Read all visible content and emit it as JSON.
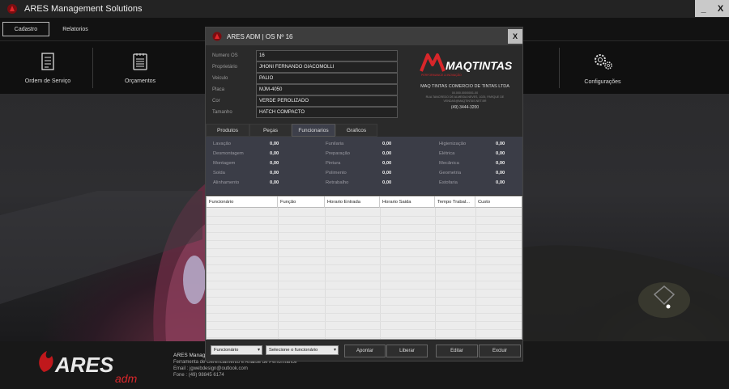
{
  "window": {
    "title": "ARES Management Solutions",
    "minimize_label": "_",
    "close_label": "X"
  },
  "menu": {
    "items": [
      {
        "label": "Cadastro"
      },
      {
        "label": "Relatorios"
      }
    ]
  },
  "ribbon": {
    "items": [
      {
        "label": "Ordem de Serviço",
        "icon": "document-icon"
      },
      {
        "label": "Orçamentos",
        "icon": "list-icon"
      },
      {
        "label": "Configurações",
        "icon": "gears-icon"
      }
    ]
  },
  "footer": {
    "brand_main": "ARES",
    "brand_sub": "adm",
    "app_name": "ARES Manage",
    "app_desc": "Ferramenta de Gerenciamento e Análise de Performance",
    "email_label": "Email",
    "email": "jgwebdesign@outlook.com",
    "phone_label": "Fone",
    "phone": "(49) 98845 6174"
  },
  "modal": {
    "title": "ARES ADM | OS Nº 16",
    "close_label": "X",
    "fields": [
      {
        "label": "Numero OS",
        "value": "16"
      },
      {
        "label": "Proprietário",
        "value": "JHONI FERNANDO GIACOMOLLI"
      },
      {
        "label": "Veiculo",
        "value": "PALIO"
      },
      {
        "label": "Placa",
        "value": "MJM-4050"
      },
      {
        "label": "Cor",
        "value": "VERDE PEROLIZADO"
      },
      {
        "label": "Tamanho",
        "value": "HATCH COMPACTO"
      }
    ],
    "company": {
      "logo_text": "MAQTINTAS",
      "logo_tagline": "PERFORMANCE & INOVAÇÃO",
      "name": "MAQ TINTAS COMERCIO DE TINTAS LTDA",
      "address_1": "00.000.000/0001-00",
      "address_2": "RUA TANCREDO DE ALMEIDA NEVES, 1025, PARQUE DE",
      "address_3": "VENDAS@MAQTINTAS.NET.BR",
      "phone": "(49) 3444-3200"
    },
    "tabs": [
      {
        "label": "Produtos",
        "active": false
      },
      {
        "label": "Peças",
        "active": false
      },
      {
        "label": "Funcionarios",
        "active": true
      },
      {
        "label": "Graficos",
        "active": false
      }
    ],
    "stats": [
      {
        "label": "Lavação",
        "value": "0,00"
      },
      {
        "label": "Desmontagem",
        "value": "0,00"
      },
      {
        "label": "Montagem",
        "value": "0,00"
      },
      {
        "label": "Solda",
        "value": "0,00"
      },
      {
        "label": "Alinhamento",
        "value": "0,00"
      },
      {
        "label": "Funilaria",
        "value": "0,00"
      },
      {
        "label": "Preparação",
        "value": "0,00"
      },
      {
        "label": "Pintura",
        "value": "0,00"
      },
      {
        "label": "Polimento",
        "value": "0,00"
      },
      {
        "label": "Retrabalho",
        "value": "0,00"
      },
      {
        "label": "Higienização",
        "value": "0,00"
      },
      {
        "label": "Elétrica",
        "value": "0,00"
      },
      {
        "label": "Mecânica",
        "value": "0,00"
      },
      {
        "label": "Geometria",
        "value": "0,00"
      },
      {
        "label": "Estofaria",
        "value": "0,00"
      }
    ],
    "table": {
      "columns": [
        "Funcionário",
        "Função",
        "Horario Entrada",
        "Horario Saida",
        "Tempo Trabal...",
        "Custo"
      ],
      "rows": []
    },
    "bottom": {
      "select_1": "Funcionário",
      "select_2": "Selecione o funcionário",
      "btn_apontar": "Apontar",
      "btn_liberar": "Liberar",
      "btn_editar": "Editar",
      "btn_excluir": "Excluir"
    }
  },
  "colors": {
    "accent_red": "#d8262a",
    "titlebar": "#232323",
    "stats_bg": "#3b3d47"
  }
}
